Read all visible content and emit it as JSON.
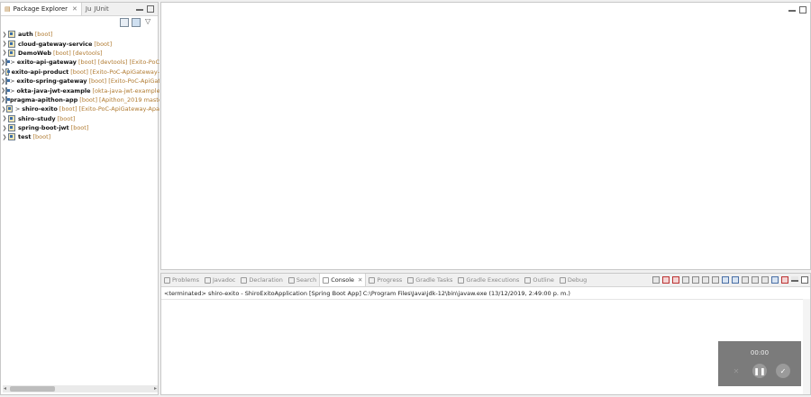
{
  "left_panel": {
    "tabs": [
      {
        "label": "Package Explorer",
        "active": true
      },
      {
        "label": "JUnit",
        "active": false
      }
    ],
    "projects": [
      {
        "prefix": "",
        "name": "auth",
        "decoration": "[boot]"
      },
      {
        "prefix": "",
        "name": "cloud-gateway-service",
        "decoration": "[boot]"
      },
      {
        "prefix": "",
        "name": "DemoWeb",
        "decoration": "[boot] [devtools]"
      },
      {
        "prefix": ">",
        "name": "exito-api-gateway",
        "decoration": "[boot] [devtools] [Exito-PoC"
      },
      {
        "prefix": "",
        "name": "exito-api-product",
        "decoration": "[boot] [Exito-PoC-ApiGateway-"
      },
      {
        "prefix": ">",
        "name": "exito-spring-gateway",
        "decoration": "[boot] [Exito-PoC-ApiGat"
      },
      {
        "prefix": ">",
        "name": "okta-java-jwt-example",
        "decoration": "[okta-java-jwt-example"
      },
      {
        "prefix": "",
        "name": "pragma-apithon-app",
        "decoration": "[boot] [Apithon_2019 maste"
      },
      {
        "prefix": ">",
        "name": "shiro-exito",
        "decoration": "[boot] [Exito-PoC-ApiGateway-Apa"
      },
      {
        "prefix": "",
        "name": "shiro-study",
        "decoration": "[boot]"
      },
      {
        "prefix": "",
        "name": "spring-boot-jwt",
        "decoration": "[boot]"
      },
      {
        "prefix": "",
        "name": "test",
        "decoration": "[boot]"
      }
    ]
  },
  "bottom_panel": {
    "tabs": [
      {
        "label": "Problems",
        "active": false
      },
      {
        "label": "Javadoc",
        "active": false
      },
      {
        "label": "Declaration",
        "active": false
      },
      {
        "label": "Search",
        "active": false
      },
      {
        "label": "Console",
        "active": true
      },
      {
        "label": "Progress",
        "active": false
      },
      {
        "label": "Gradle Tasks",
        "active": false
      },
      {
        "label": "Gradle Executions",
        "active": false
      },
      {
        "label": "Outline",
        "active": false
      },
      {
        "label": "Debug",
        "active": false
      }
    ],
    "console_header": "<terminated> shiro-exito - ShiroExitoApplication [Spring Boot App] C:\\Program Files\\Java\\jdk-12\\bin\\javaw.exe (13/12/2019, 2:49:00 p. m.)"
  },
  "recorder": {
    "time": "00:00"
  },
  "colors": {
    "decoration": "#b07a30",
    "panel_border": "#c8c8c8"
  }
}
